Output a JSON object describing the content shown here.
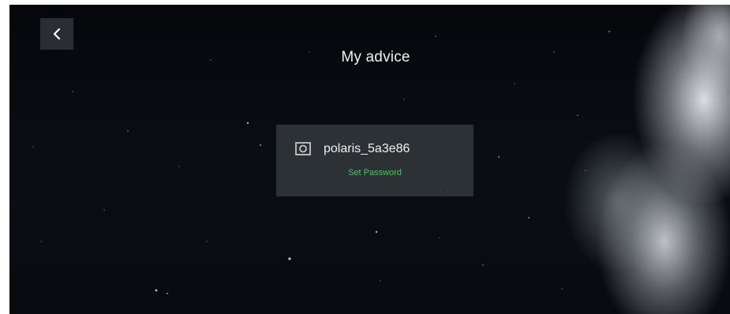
{
  "header": {
    "title": "My advice",
    "back_icon": "chevron-left-icon"
  },
  "device": {
    "icon": "device-icon",
    "name": "polaris_5a3e86",
    "set_password_label": "Set Password",
    "set_password_color": "#4cc25a"
  }
}
